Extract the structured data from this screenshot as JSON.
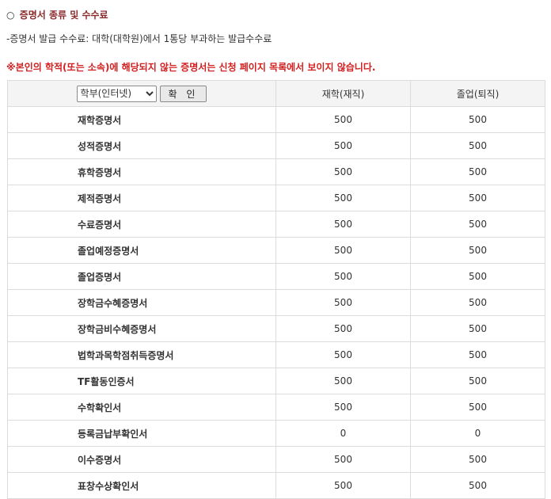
{
  "section": {
    "title": "증명서 종류 및 수수료",
    "circle": "○",
    "fee_note": "-증명서 발급 수수료: 대학(대학원)에서 1통당 부과하는 발급수수료",
    "warning": "※본인의 학적(또는 소속)에 해당되지 않는 증명서는 신청 페이지 목록에서 보이지 않습니다."
  },
  "filter": {
    "selected": "학부(인터넷)",
    "confirm_label": "확 인"
  },
  "table": {
    "columns": [
      "재학(재직)",
      "졸업(퇴직)"
    ],
    "rows": [
      {
        "name": "재학증명서",
        "enrolled": "500",
        "graduated": "500"
      },
      {
        "name": "성적증명서",
        "enrolled": "500",
        "graduated": "500"
      },
      {
        "name": "휴학증명서",
        "enrolled": "500",
        "graduated": "500"
      },
      {
        "name": "제적증명서",
        "enrolled": "500",
        "graduated": "500"
      },
      {
        "name": "수료증명서",
        "enrolled": "500",
        "graduated": "500"
      },
      {
        "name": "졸업예정증명서",
        "enrolled": "500",
        "graduated": "500"
      },
      {
        "name": "졸업증명서",
        "enrolled": "500",
        "graduated": "500"
      },
      {
        "name": "장학금수혜증명서",
        "enrolled": "500",
        "graduated": "500"
      },
      {
        "name": "장학금비수혜증명서",
        "enrolled": "500",
        "graduated": "500"
      },
      {
        "name": "법학과목학점취득증명서",
        "enrolled": "500",
        "graduated": "500"
      },
      {
        "name": "TF활동인증서",
        "enrolled": "500",
        "graduated": "500"
      },
      {
        "name": "수학확인서",
        "enrolled": "500",
        "graduated": "500"
      },
      {
        "name": "등록금납부확인서",
        "enrolled": "0",
        "graduated": "0"
      },
      {
        "name": "이수증명서",
        "enrolled": "500",
        "graduated": "500"
      },
      {
        "name": "표창수상확인서",
        "enrolled": "500",
        "graduated": "500"
      }
    ]
  }
}
